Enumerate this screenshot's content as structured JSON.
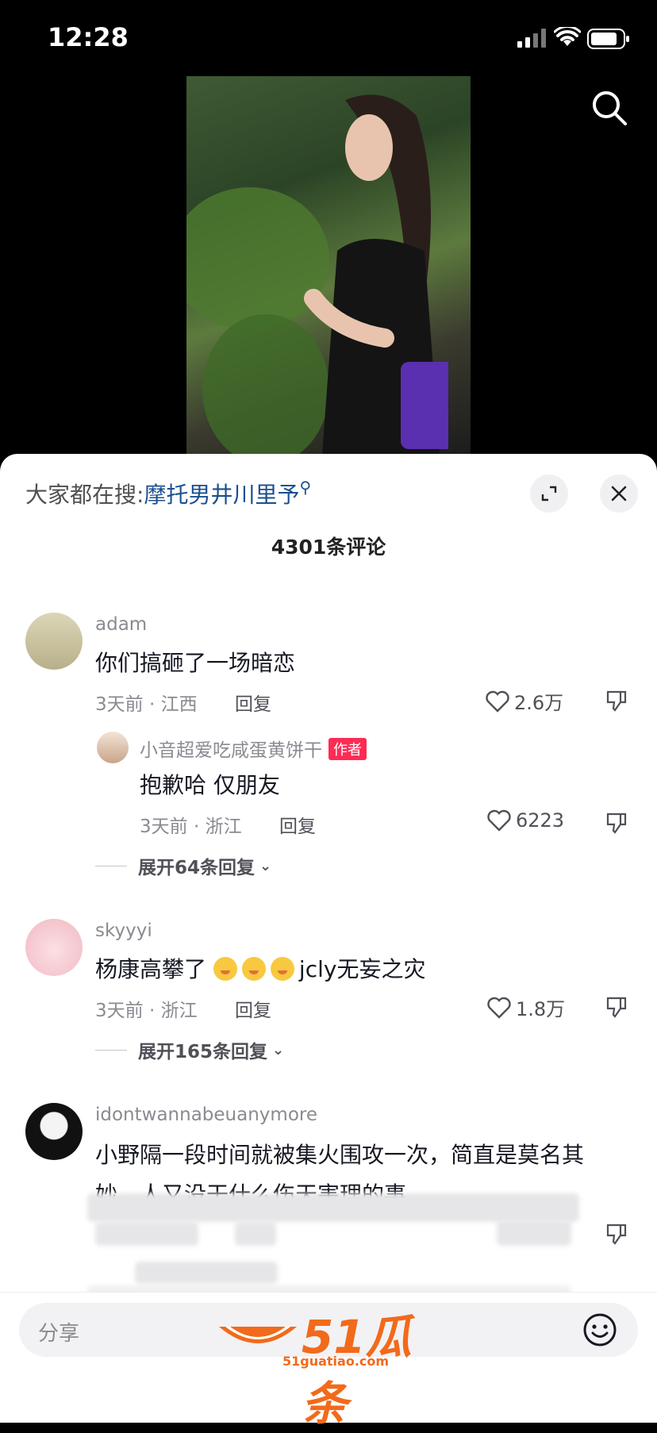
{
  "status_bar": {
    "time": "12:28"
  },
  "search_bar": {
    "prefix": "大家都在搜:",
    "keyword": "摩托男井川里予"
  },
  "comments_header": {
    "count_label": "4301条评论"
  },
  "comments": [
    {
      "username": "adam",
      "text": "你们搞砸了一场暗恋",
      "time_location": "3天前 · 江西",
      "reply_label": "回复",
      "likes": "2.6万"
    },
    {
      "username": "skyyyi",
      "text_prefix": "杨康高攀了",
      "text_suffix": "jcly无妄之灾",
      "time_location": "3天前 · 浙江",
      "reply_label": "回复",
      "likes": "1.8万"
    },
    {
      "username": "idontwannabeuanymore",
      "text_line1": "小野隔一段时间就被集火围攻一次，简直是莫名其",
      "text_line2": "妙，人又没干什么伤天害理的事"
    }
  ],
  "author_reply": {
    "username": "小音超爱吃咸蛋黄饼干",
    "badge": "作者",
    "text": "抱歉哈 仅朋友",
    "time_location": "3天前 · 浙江",
    "reply_label": "回复",
    "likes": "6223"
  },
  "expand_replies": [
    "展开64条回复",
    "展开165条回复"
  ],
  "input_bar": {
    "placeholder": "分享"
  },
  "watermark": {
    "logo": "51瓜条",
    "url": "51guatiao.com"
  },
  "colors": {
    "accent_red": "#fe2c55",
    "search_keyword": "#1b4f8f",
    "watermark": "#f26a1b"
  }
}
